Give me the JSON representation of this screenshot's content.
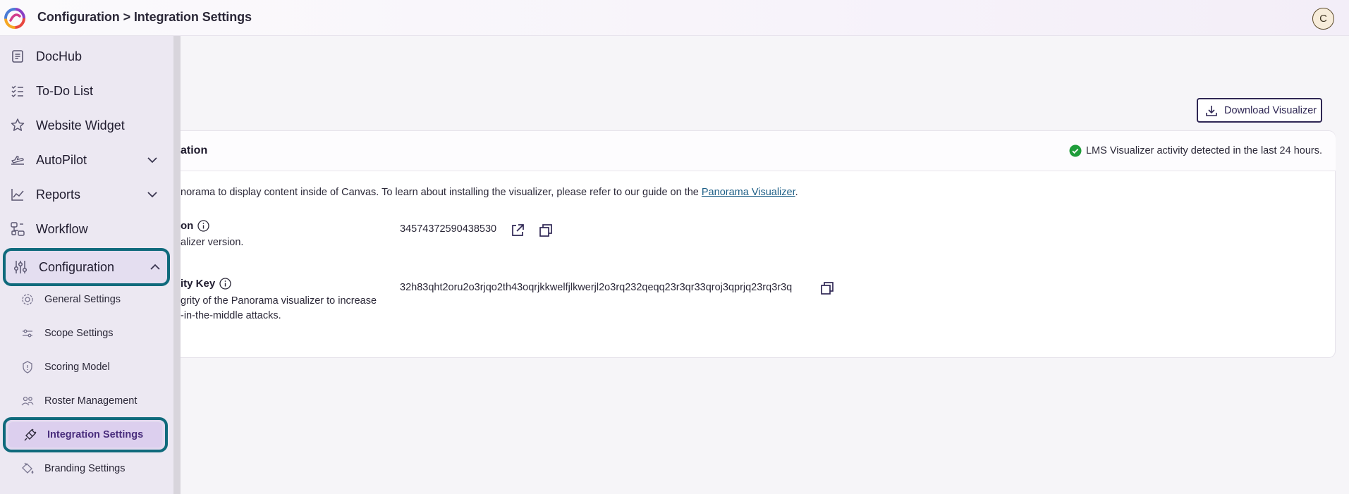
{
  "header": {
    "breadcrumb": "Configuration > Integration Settings",
    "avatar_initial": "C"
  },
  "sidebar": {
    "items": [
      {
        "label": "DocHub",
        "icon": "document-icon"
      },
      {
        "label": "To-Do List",
        "icon": "checklist-icon"
      },
      {
        "label": "Website Widget",
        "icon": "widget-icon"
      },
      {
        "label": "AutoPilot",
        "icon": "airplane-icon",
        "expandable": true,
        "expanded": false
      },
      {
        "label": "Reports",
        "icon": "chart-icon",
        "expandable": true,
        "expanded": false
      },
      {
        "label": "Workflow",
        "icon": "workflow-icon"
      },
      {
        "label": "Configuration",
        "icon": "sliders-icon",
        "expandable": true,
        "expanded": true,
        "active": true
      }
    ],
    "sub_items": [
      {
        "label": "General Settings",
        "icon": "gear-icon"
      },
      {
        "label": "Scope Settings",
        "icon": "scope-icon"
      },
      {
        "label": "Scoring Model",
        "icon": "scoring-icon"
      },
      {
        "label": "Roster Management",
        "icon": "users-icon"
      },
      {
        "label": "Integration Settings",
        "icon": "plug-icon",
        "active": true
      },
      {
        "label": "Branding Settings",
        "icon": "paint-icon"
      }
    ]
  },
  "main": {
    "download_button": "Download Visualizer",
    "card": {
      "title": "ation",
      "status": "LMS Visualizer activity detected in the last 24 hours.",
      "description_prefix": "norama to display content inside of Canvas. To learn about installing the visualizer, please refer to our guide on the ",
      "description_link": "Panorama Visualizer",
      "description_suffix": ".",
      "fields": [
        {
          "label": "on",
          "help_lines": [
            "alizer version."
          ],
          "value": "34574372590438530"
        },
        {
          "label": "ity Key",
          "help_lines": [
            "grity of the Panorama visualizer to increase",
            "-in-the-middle attacks."
          ],
          "value": "32h83qht2oru2o3rjqo2th43oqrjkkwelfjlkwerjl2o3rq232qeqq23r3qr33qroj3qprjq23rq3r3q"
        }
      ]
    }
  },
  "colors": {
    "accent_border": "#0f6a7c",
    "sidebar_bg": "#ece8f2",
    "active_sub_text": "#4a2e7d",
    "success": "#1f9d3a",
    "link": "#1c5e86"
  }
}
